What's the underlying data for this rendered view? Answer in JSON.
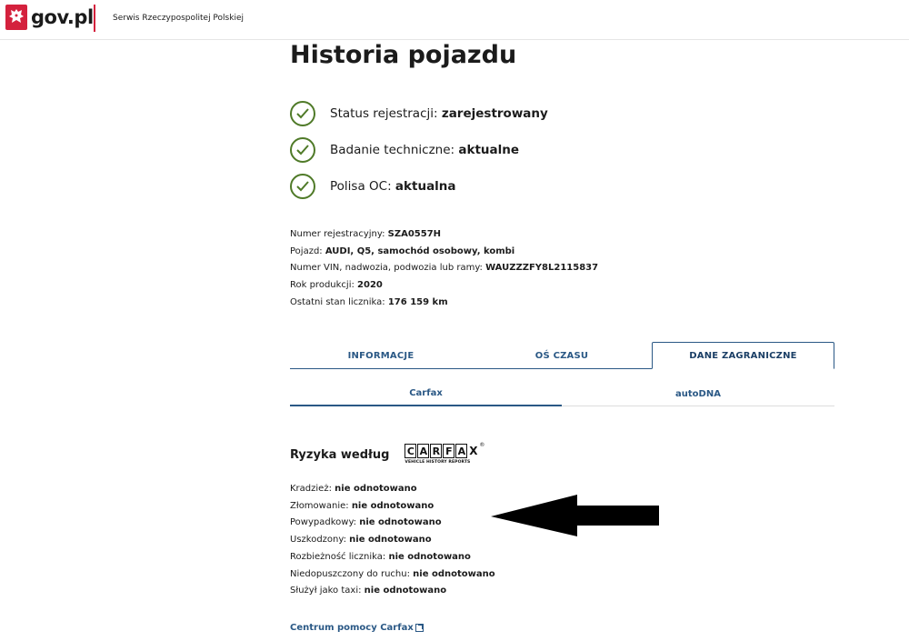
{
  "header": {
    "logo_text": "gov.pl",
    "service_name": "Serwis Rzeczypospolitej Polskiej",
    "brand_color": "#d4213d"
  },
  "page": {
    "title": "Historia pojazdu"
  },
  "status": [
    {
      "label": "Status rejestracji:",
      "value": "zarejestrowany",
      "icon": "check-circle-icon"
    },
    {
      "label": "Badanie techniczne:",
      "value": "aktualne",
      "icon": "check-circle-icon"
    },
    {
      "label": "Polisa OC:",
      "value": "aktualna",
      "icon": "check-circle-icon"
    }
  ],
  "details": [
    {
      "label": "Numer rejestracyjny:",
      "value": "SZA0557H"
    },
    {
      "label": "Pojazd:",
      "value": "AUDI, Q5, samochód osobowy, kombi"
    },
    {
      "label": "Numer VIN, nadwozia, podwozia lub ramy:",
      "value": "WAUZZZFY8L2115837"
    },
    {
      "label": "Rok produkcji:",
      "value": "2020"
    },
    {
      "label": "Ostatni stan licznika:",
      "value": "176 159 km"
    }
  ],
  "tabs": [
    {
      "label": "INFORMACJE",
      "active": false
    },
    {
      "label": "OŚ CZASU",
      "active": false
    },
    {
      "label": "DANE ZAGRANICZNE",
      "active": true
    }
  ],
  "subtabs": [
    {
      "label": "Carfax",
      "active": true
    },
    {
      "label": "autoDNA",
      "active": false
    }
  ],
  "risk": {
    "heading": "Ryzyka według",
    "carfax_letters": [
      "C",
      "A",
      "R",
      "F",
      "A",
      "X"
    ],
    "carfax_tagline": "VEHICLE HISTORY REPORTS",
    "carfax_reg": "®",
    "items": [
      {
        "label": "Kradzież:",
        "value": "nie odnotowano"
      },
      {
        "label": "Złomowanie:",
        "value": "nie odnotowano"
      },
      {
        "label": "Powypadkowy:",
        "value": "nie odnotowano"
      },
      {
        "label": "Uszkodzony:",
        "value": "nie odnotowano"
      },
      {
        "label": "Rozbieżność licznika:",
        "value": "nie odnotowano"
      },
      {
        "label": "Niedopuszczony do ruchu:",
        "value": "nie odnotowano"
      },
      {
        "label": "Służył jako taxi:",
        "value": "nie odnotowano"
      }
    ]
  },
  "help": {
    "label": "Centrum pomocy Carfax",
    "icon": "external-link-icon"
  },
  "colors": {
    "link": "#2a5885",
    "check": "#4f7a28"
  }
}
